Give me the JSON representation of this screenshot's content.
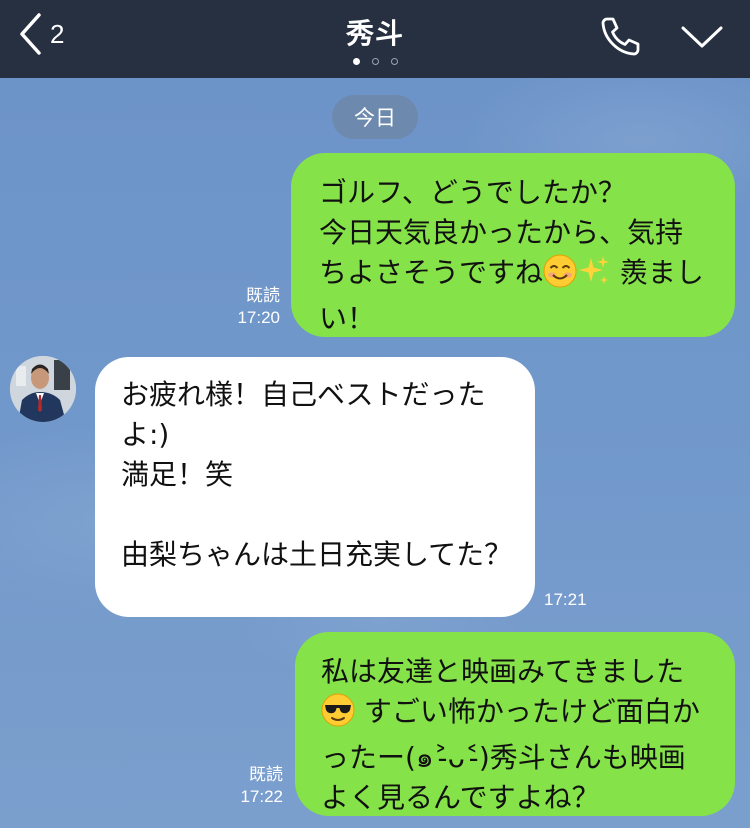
{
  "header": {
    "back_count": "2",
    "title": "秀斗",
    "page_dots": 3,
    "active_dot": 0
  },
  "date_label": "今日",
  "messages": [
    {
      "direction": "outgoing",
      "parts": [
        "ゴルフ、どうでしたか？\n今日天気良かったから、気持ちよさそうですね",
        " 羨ましい！"
      ],
      "emojis": [
        "smiling-face-emoji",
        "sparkles-emoji"
      ],
      "read_label": "既読",
      "time": "17:20"
    },
    {
      "direction": "incoming",
      "text": "お疲れ様！自己ベストだったよ:)\n満足！笑\n\n由梨ちゃんは土日充実してた？",
      "time": "17:21"
    },
    {
      "direction": "outgoing",
      "parts": [
        "私は友達と映画みてきました",
        " すごい怖かったけど面白かったー(๑˃̵ᴗ˂̵)秀斗さんも映画よく見るんですよね？"
      ],
      "emojis": [
        "sunglasses-face-emoji"
      ],
      "read_label": "既読",
      "time": "17:22"
    }
  ],
  "colors": {
    "header_bg": "#263040",
    "chat_bg": "#7096c8",
    "outgoing_bubble": "#85e249",
    "incoming_bubble": "#ffffff"
  }
}
